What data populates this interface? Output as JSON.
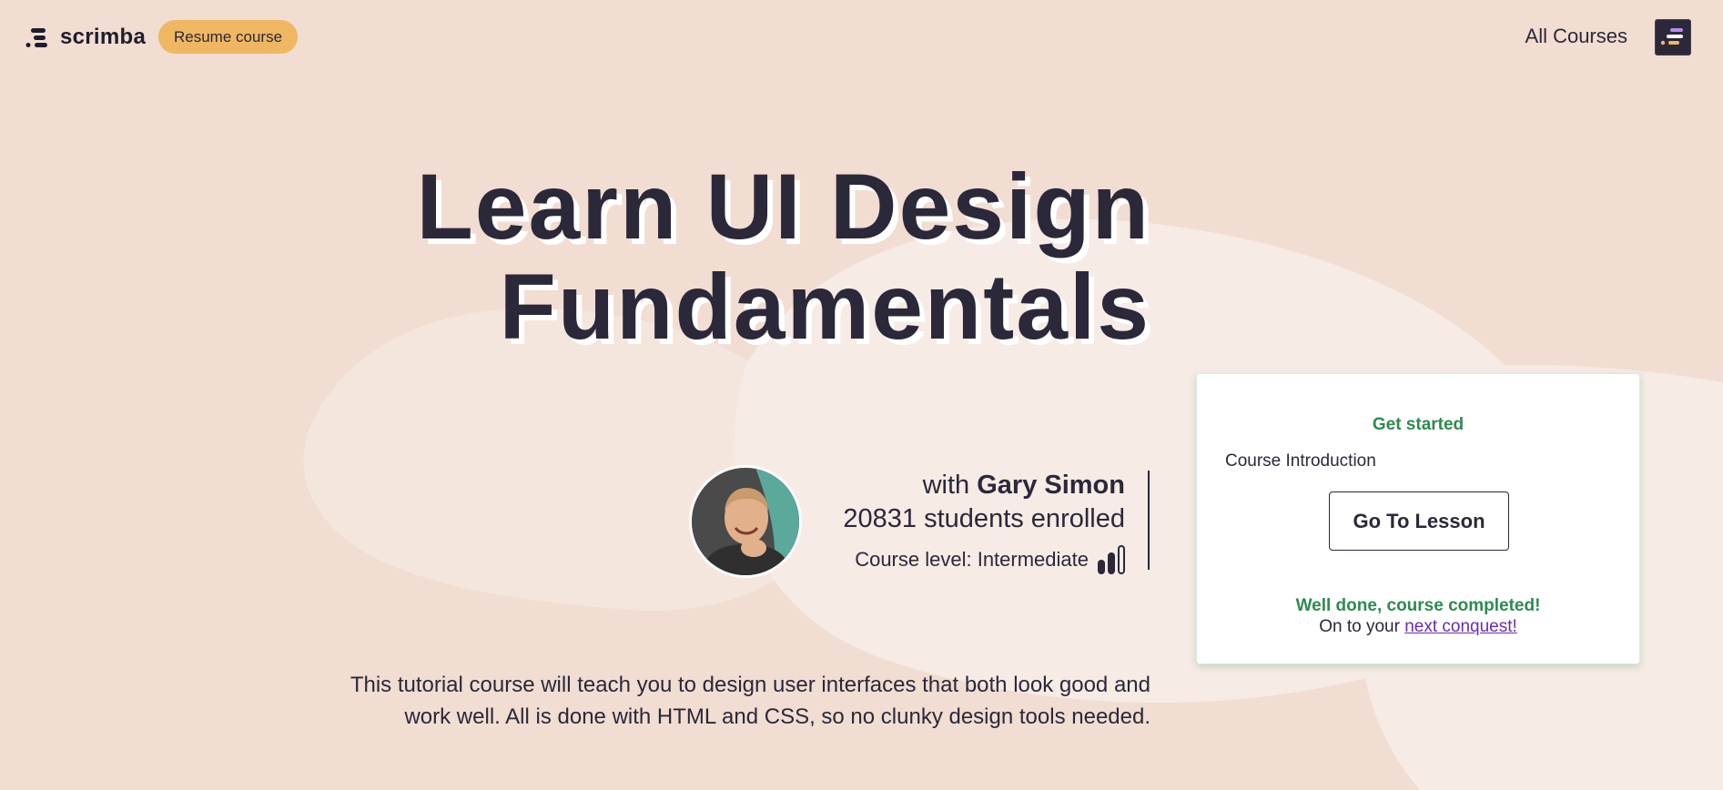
{
  "header": {
    "brand": "scrimba",
    "resume_label": "Resume course",
    "all_courses_label": "All Courses"
  },
  "course": {
    "title_line1": "Learn UI Design",
    "title_line2": "Fundamentals",
    "with_prefix": "with",
    "instructor": "Gary Simon",
    "enrolled": "20831 students enrolled",
    "level_label": "Course level: Intermediate",
    "level": {
      "filled": 2,
      "total": 3
    },
    "description": "This tutorial course will teach you to design user interfaces that both look good and work well. All is done with HTML and CSS, so no clunky design tools needed."
  },
  "card": {
    "get_started": "Get started",
    "lesson_name": "Course Introduction",
    "go_button": "Go To Lesson",
    "well_done": "Well done, course completed!",
    "next_prefix": "On to your",
    "next_link": "next conquest!"
  },
  "colors": {
    "background": "#f1ddd1",
    "accent_yellow": "#f0b762",
    "dark": "#2b283a",
    "success_green": "#2f8a4f",
    "link_purple": "#6b2bb0"
  },
  "icons": [
    "scrimba-logo-icon",
    "user-avatar-icon",
    "level-bars-icon"
  ]
}
